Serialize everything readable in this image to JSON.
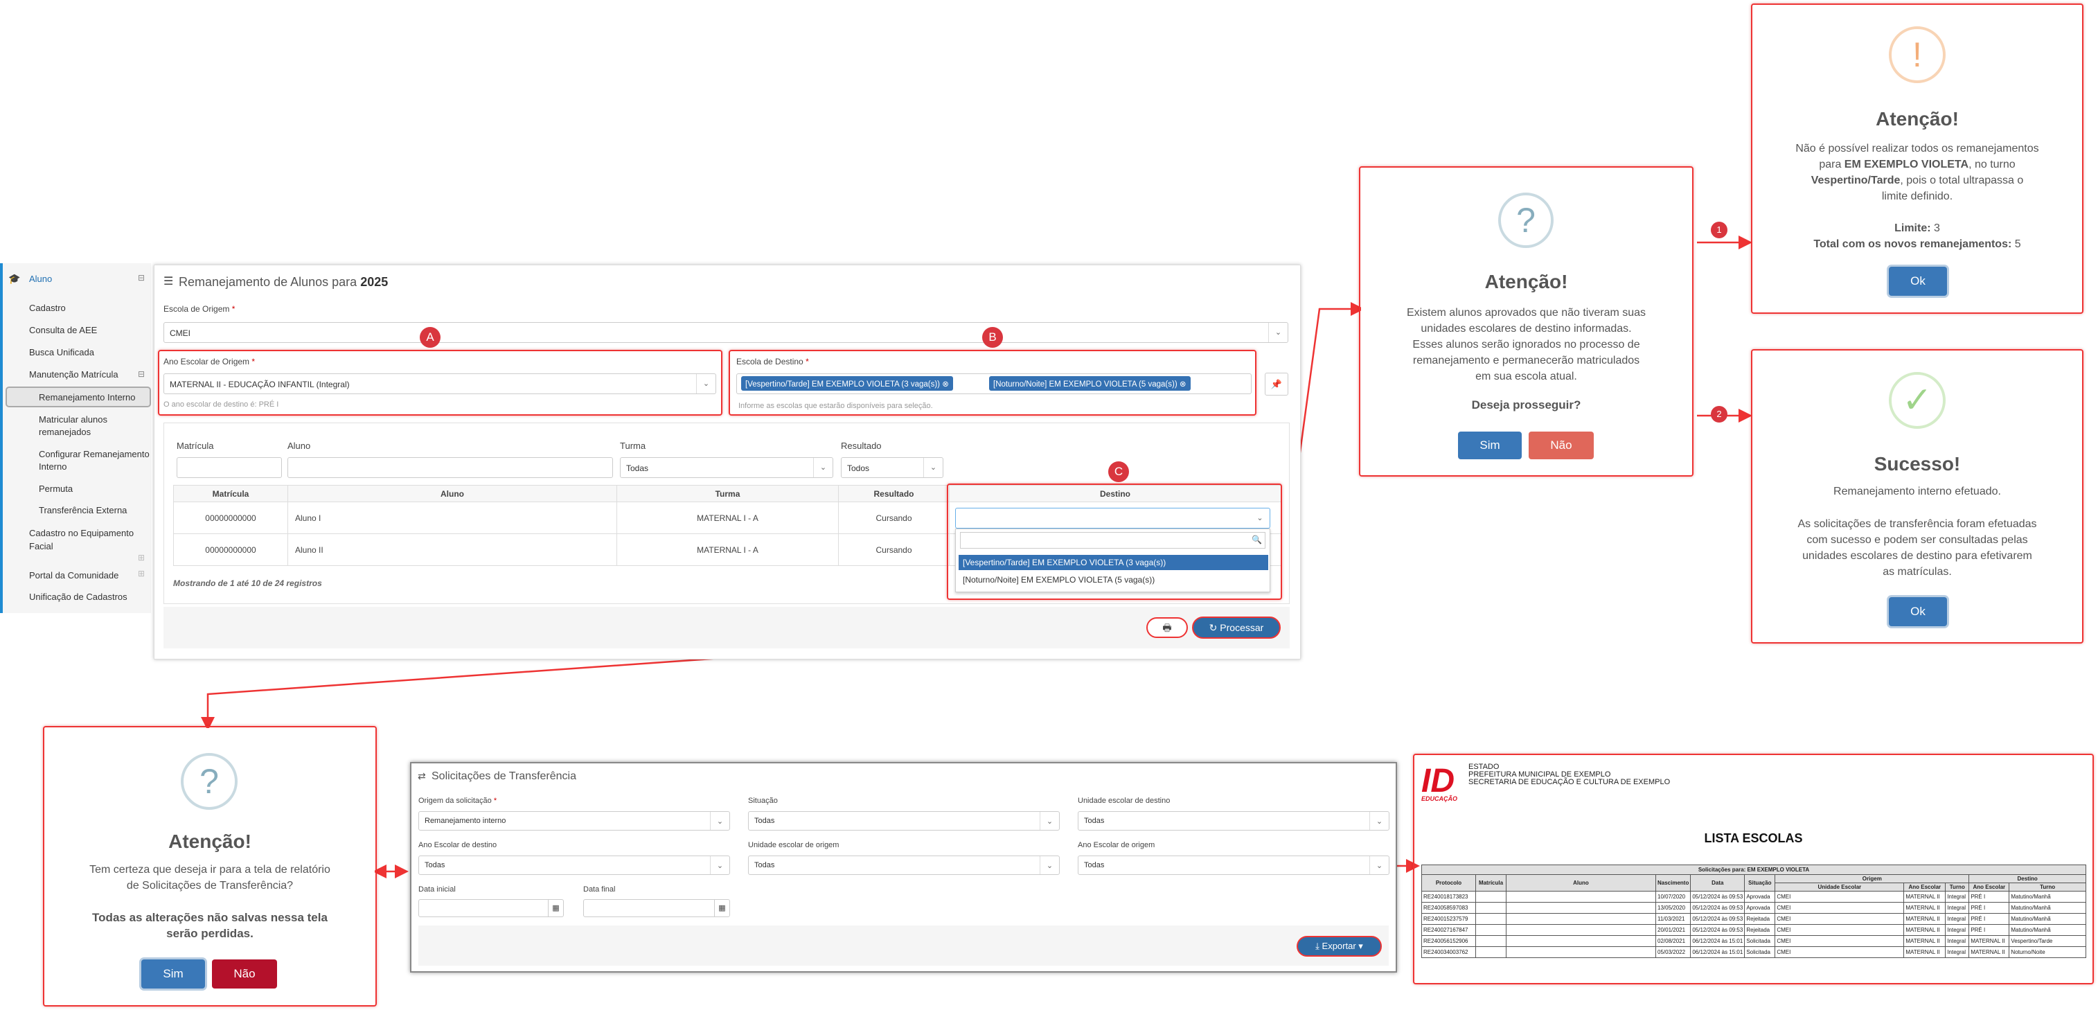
{
  "sidebar": {
    "section": "Aluno",
    "items": [
      "Cadastro",
      "Consulta de AEE",
      "Busca Unificada",
      "Manutenção Matrícula",
      "Remanejamento Interno",
      "Matricular alunos remanejados",
      "Configurar Remanejamento Interno",
      "Permuta",
      "Transferência Externa",
      "Cadastro no Equipamento Facial",
      "Portal da Comunidade",
      "Unificação de Cadastros"
    ]
  },
  "form": {
    "title_prefix": "Remanejamento de Alunos para",
    "year": "2025",
    "origin_school_label": "Escola de Origem",
    "origin_school_value": "CMEI",
    "grade_label": "Ano Escolar de Origem",
    "grade_value": "MATERNAL II - EDUCAÇÃO INFANTIL (Integral)",
    "grade_hint": "O ano escolar de destino é: PRÉ I",
    "dest_school_label": "Escola de Destino",
    "dest_tags": [
      "[Vespertino/Tarde] EM EXEMPLO VIOLETA (3 vaga(s))",
      "[Noturno/Noite] EM EXEMPLO VIOLETA (5 vaga(s))"
    ],
    "dest_hint": "Informe as escolas que estarão disponíveis para seleção.",
    "filters": {
      "matricula": "Matrícula",
      "aluno": "Aluno",
      "turma": "Turma",
      "turma_value": "Todas",
      "resultado": "Resultado",
      "resultado_value": "Todos"
    },
    "table": {
      "headers": [
        "Matrícula",
        "Aluno",
        "Turma",
        "Resultado",
        "Destino"
      ],
      "rows": [
        [
          "00000000000",
          "Aluno I",
          "MATERNAL I - A",
          "Cursando"
        ],
        [
          "00000000000",
          "Aluno II",
          "MATERNAL I - A",
          "Cursando"
        ]
      ]
    },
    "dropdown_options": [
      "[Vespertino/Tarde] EM EXEMPLO VIOLETA (3 vaga(s))",
      "[Noturno/Noite] EM EXEMPLO VIOLETA (5 vaga(s))"
    ],
    "footer": "Mostrando de 1 até 10 de 24 registros",
    "process_label": "Processar"
  },
  "markers": {
    "a": "A",
    "b": "B",
    "c": "C",
    "one": "1",
    "two": "2"
  },
  "modal_confirm": {
    "title": "Atenção!",
    "body": [
      "Existem alunos aprovados que não tiveram suas",
      "unidades escolares de destino informadas.",
      "Esses alunos serão ignorados no processo de",
      "remanejamento e permanecerão matriculados",
      "em sua escola atual."
    ],
    "question": "Deseja prosseguir?",
    "yes": "Sim",
    "no": "Não"
  },
  "modal_warning": {
    "title": "Atenção!",
    "line1": "Não é possível realizar todos os remanejamentos",
    "line2a": "para ",
    "school": "EM EXEMPLO VIOLETA",
    "line2b": ", no turno",
    "shift": "Vespertino/Tarde",
    "line3b": ", pois o total ultrapassa o",
    "line4": "limite definido.",
    "limit_label": "Limite:",
    "limit_value": "3",
    "total_label": "Total com os novos remanejamentos:",
    "total_value": "5",
    "ok": "Ok"
  },
  "modal_success": {
    "title": "Sucesso!",
    "line1": "Remanejamento interno efetuado.",
    "body": [
      "As solicitações de transferência foram efetuadas",
      "com sucesso e podem ser consultadas pelas",
      "unidades escolares de destino para efetivarem",
      "as matrículas."
    ],
    "ok": "Ok"
  },
  "modal_leave": {
    "title": "Atenção!",
    "body": [
      "Tem certeza que deseja ir para a tela de relatório",
      "de Solicitações de Transferência?"
    ],
    "bold": [
      "Todas as alterações não salvas nessa tela",
      "serão perdidas."
    ],
    "yes": "Sim",
    "no": "Não"
  },
  "requests": {
    "title": "Solicitações de Transferência",
    "origin_label": "Origem da solicitação",
    "origin_value": "Remanejamento interno",
    "status_label": "Situação",
    "status_value": "Todas",
    "dest_unit_label": "Unidade escolar de destino",
    "dest_unit_value": "Todas",
    "dest_grade_label": "Ano Escolar de destino",
    "dest_grade_value": "Todas",
    "origin_unit_label": "Unidade escolar de origem",
    "origin_unit_value": "Todas",
    "origin_grade_label": "Ano Escolar de origem",
    "origin_grade_value": "Todas",
    "start_label": "Data inicial",
    "end_label": "Data final",
    "export_label": "Exportar"
  },
  "report": {
    "header": [
      "ESTADO",
      "PREFEITURA MUNICIPAL DE EXEMPLO",
      "SECRETARIA DE EDUCAÇÃO E CULTURA DE EXEMPLO"
    ],
    "logo_text": "EDUCAÇÃO",
    "title": "LISTA ESCOLAS",
    "subtitle": "Solicitações para: EM EXEMPLO VIOLETA",
    "group_origin": "Origem",
    "group_dest": "Destino",
    "cols": [
      "Protocolo",
      "Matrícula",
      "Aluno",
      "Nascimento",
      "Data",
      "Situação",
      "Unidade Escolar",
      "Ano Escolar",
      "Turno",
      "Ano Escolar",
      "Turno"
    ],
    "rows": [
      [
        "RE240018173823",
        "",
        "",
        "10/07/2020",
        "05/12/2024 às 09:53",
        "Aprovada",
        "CMEI",
        "MATERNAL II",
        "Integral",
        "PRÉ I",
        "Matutino/Manhã"
      ],
      [
        "RE240058597083",
        "",
        "",
        "13/05/2020",
        "05/12/2024 às 09:53",
        "Aprovada",
        "CMEI",
        "MATERNAL II",
        "Integral",
        "PRÉ I",
        "Matutino/Manhã"
      ],
      [
        "RE240015237579",
        "",
        "",
        "11/03/2021",
        "05/12/2024 às 09:53",
        "Rejeitada",
        "CMEI",
        "MATERNAL II",
        "Integral",
        "PRÉ I",
        "Matutino/Manhã"
      ],
      [
        "RE240027167847",
        "",
        "",
        "20/01/2021",
        "05/12/2024 às 09:53",
        "Rejeitada",
        "CMEI",
        "MATERNAL II",
        "Integral",
        "PRÉ I",
        "Matutino/Manhã"
      ],
      [
        "RE240056152906",
        "",
        "",
        "02/08/2021",
        "06/12/2024 às 15:01",
        "Solicitada",
        "CMEI",
        "MATERNAL II",
        "Integral",
        "MATERNAL II",
        "Vespertino/Tarde"
      ],
      [
        "RE240034003762",
        "",
        "",
        "05/03/2022",
        "06/12/2024 às 15:01",
        "Solicitada",
        "CMEI",
        "MATERNAL II",
        "Integral",
        "MATERNAL II",
        "Noturno/Noite"
      ]
    ]
  }
}
